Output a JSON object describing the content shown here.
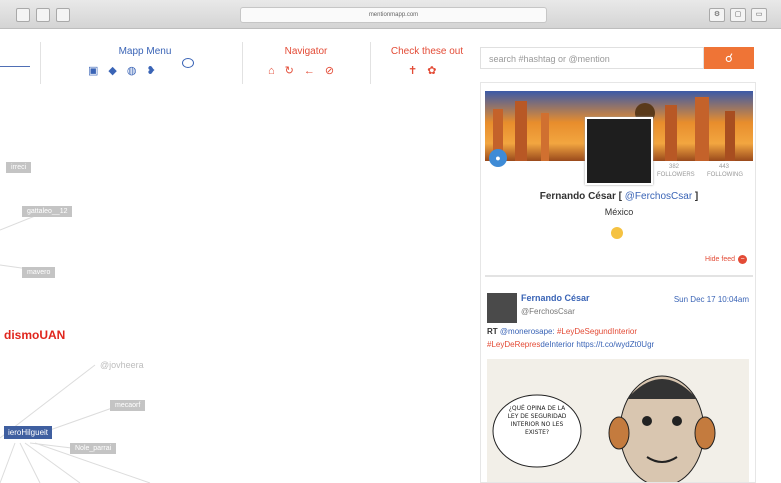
{
  "browser": {
    "url": "mentionmapp.com",
    "right_buttons": [
      "⚙",
      "▢",
      "▭"
    ]
  },
  "menus": {
    "mapp_menu": {
      "title": "Mapp Menu",
      "icons": [
        "save-icon",
        "layers-icon",
        "globe-icon",
        "twitter-icon"
      ]
    },
    "navigator": {
      "title": "Navigator",
      "icons": [
        "home-icon",
        "refresh-icon",
        "back-icon",
        "stop-icon"
      ]
    },
    "check_these_out": {
      "title": "Check these out",
      "icons": [
        "pin-icon",
        "group-icon"
      ]
    }
  },
  "search": {
    "placeholder": "search #hashtag or @mention"
  },
  "graph": {
    "nodes": [
      {
        "label": "irreci"
      },
      {
        "label": "gattaleo__12"
      },
      {
        "label": "mavero"
      },
      {
        "label": "dismoUAN"
      },
      {
        "label": "@jovheera"
      },
      {
        "label": "mecaorf"
      },
      {
        "label": "ieroHilgueit"
      },
      {
        "label": "Nole_parrai"
      }
    ]
  },
  "profile": {
    "name": "Fernando César",
    "handle": "@FerchosCsar",
    "location": "México",
    "stats": [
      {
        "value": "382",
        "label": "FOLLOWERS"
      },
      {
        "value": "443",
        "label": "FOLLOWING"
      }
    ],
    "hide_feed": "Hide feed"
  },
  "tweet": {
    "name": "Fernando César",
    "handle": "@FerchosCsar",
    "date": "Sun Dec 17 10:04am",
    "rt": "RT",
    "mention": "@monerosape:",
    "hashtag1": "#LeyDeSegundInterior",
    "hashtag2": "#LeyDeRepres",
    "rest": "deInterior https://t.co/wydZt0Ugr"
  },
  "cartoon": {
    "speech": "¿QUÉ OPINA DE LA LEY DE SEGURIDAD INTERIOR NO LES EXISTE?"
  }
}
